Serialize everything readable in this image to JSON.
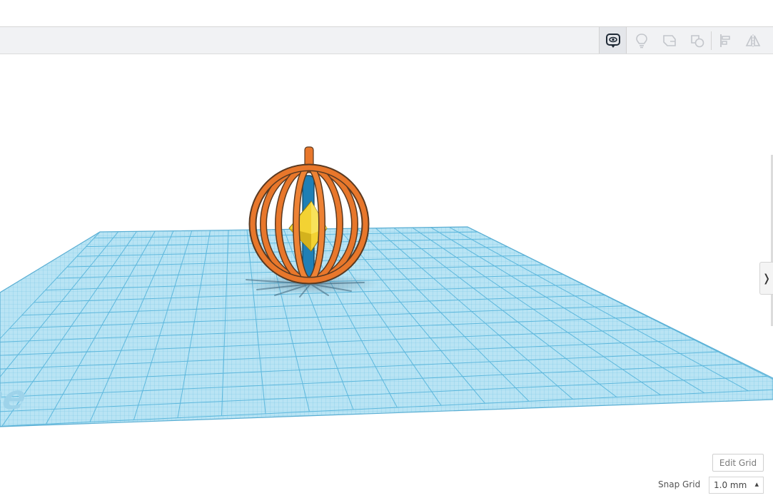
{
  "toolbar": {
    "buttons": [
      {
        "name": "show-all-icon",
        "label": "Show all",
        "active": true
      },
      {
        "name": "lightbulb-icon",
        "label": "Notes"
      },
      {
        "name": "group-icon",
        "label": "Group"
      },
      {
        "name": "ungroup-icon",
        "label": "Ungroup"
      },
      {
        "name": "align-icon",
        "label": "Align"
      },
      {
        "name": "mirror-icon",
        "label": "Mirror"
      }
    ]
  },
  "workplane": {
    "label": "Workplane",
    "visible_label": "kplane"
  },
  "panel_toggle": {
    "glyph": "❭"
  },
  "edit_grid": {
    "label": "Edit Grid"
  },
  "snap_grid": {
    "label": "Snap Grid",
    "value": "1.0 mm",
    "caret": "▴"
  },
  "colors": {
    "workplane": "#9fd8ee",
    "grid_line": "#5eb8dd",
    "object_orange": "#e8772b",
    "object_blue": "#1f7fb5",
    "object_yellow": "#f3d233"
  }
}
